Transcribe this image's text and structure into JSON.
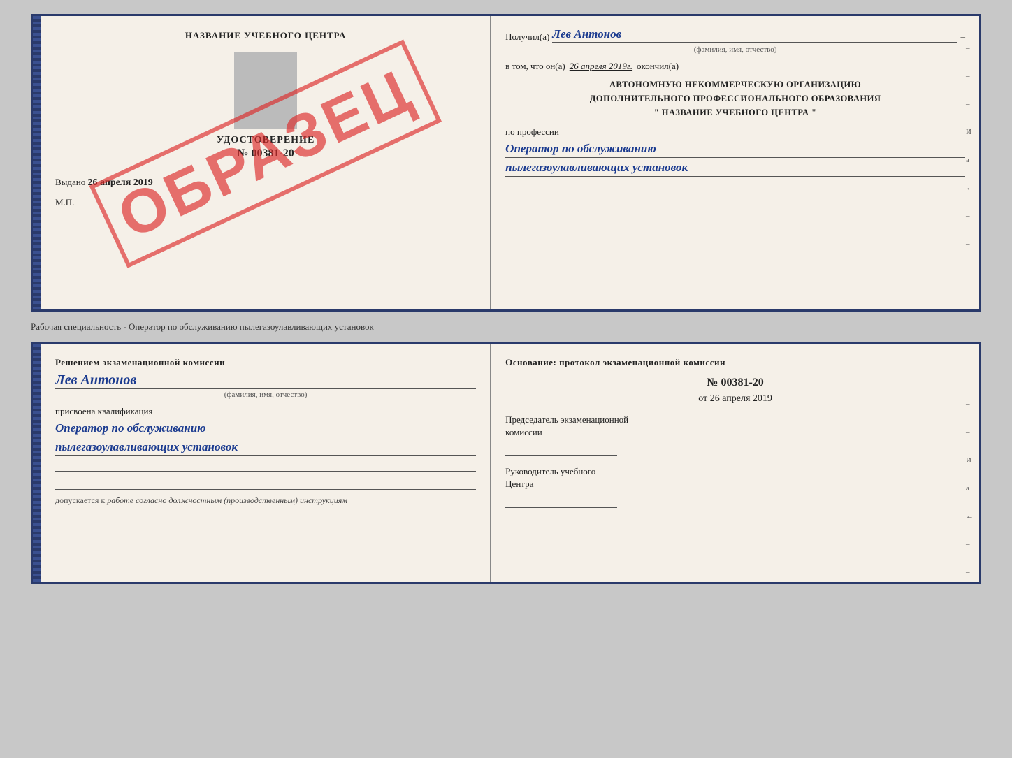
{
  "top_cert": {
    "left": {
      "title": "НАЗВАНИЕ УЧЕБНОГО ЦЕНТРА",
      "watermark": "ОБРАЗЕЦ",
      "udostoverenie_label": "УДОСТОВЕРЕНИЕ",
      "number": "№ 00381-20",
      "vydano_label": "Выдано",
      "vydano_date": "26 апреля 2019",
      "mp_label": "М.П."
    },
    "right": {
      "poluchil_label": "Получил(а)",
      "poluchil_name": "Лев Антонов",
      "fio_subtext": "(фамилия, имя, отчество)",
      "dash": "–",
      "vtom_label": "в том, что он(а)",
      "vtom_date": "26 апреля 2019г.",
      "okoncil_label": "окончил(а)",
      "org_line1": "АВТОНОМНУЮ НЕКОММЕРЧЕСКУЮ ОРГАНИЗАЦИЮ",
      "org_line2": "ДОПОЛНИТЕЛЬНОГО ПРОФЕССИОНАЛЬНОГО ОБРАЗОВАНИЯ",
      "org_quote_open": "\"",
      "org_name": "НАЗВАНИЕ УЧЕБНОГО ЦЕНТРА",
      "org_quote_close": "\"",
      "po_professii_label": "по профессии",
      "profession_line1": "Оператор по обслуживанию",
      "profession_line2": "пылегазоулавливающих установок",
      "right_dashes": [
        "–",
        "–",
        "–",
        "И",
        "а",
        "←",
        "–",
        "–"
      ]
    }
  },
  "separator": {
    "text": "Рабочая специальность - Оператор по обслуживанию пылегазоулавливающих установок"
  },
  "bottom_cert": {
    "left": {
      "resheniem_label": "Решением экзаменационной комиссии",
      "name_cursive": "Лев Антонов",
      "fio_subtext": "(фамилия, имя, отчество)",
      "prisvoyena_label": "присвоена квалификация",
      "prof_line1": "Оператор по обслуживанию",
      "prof_line2": "пылегазоулавливающих установок",
      "dopuskaetsya_prefix": "допускается к",
      "dopuskaetsya_text": "работе согласно должностным (производственным) инструкциям"
    },
    "right": {
      "osnovanie_label": "Основание: протокол экзаменационной комиссии",
      "protokol_number": "№  00381-20",
      "ot_label": "от",
      "ot_date": "26 апреля 2019",
      "predsedatel_line1": "Председатель экзаменационной",
      "predsedatel_line2": "комиссии",
      "rukovoditel_line1": "Руководитель учебного",
      "rukovoditel_line2": "Центра",
      "right_dashes": [
        "–",
        "–",
        "–",
        "И",
        "а",
        "←",
        "–",
        "–"
      ]
    }
  }
}
